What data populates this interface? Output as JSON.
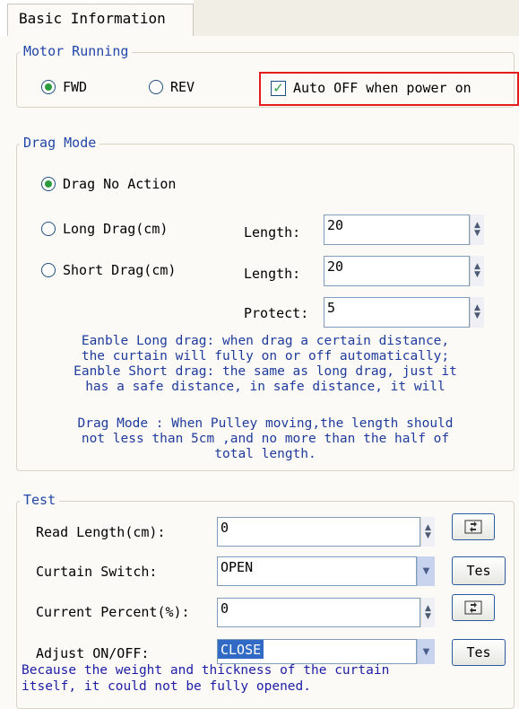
{
  "tab": {
    "label": "Basic Information"
  },
  "motor_running": {
    "legend": "Motor Running",
    "fwd_label": "FWD",
    "rev_label": "REV",
    "selected": "FWD",
    "auto_off_label": "Auto OFF when power on",
    "auto_off_checked": true
  },
  "drag_mode": {
    "legend": "Drag Mode",
    "no_action_label": "Drag No Action",
    "long_drag_label": "Long Drag(cm)",
    "short_drag_label": "Short Drag(cm)",
    "selected": "Drag No Action",
    "long_length_label": "Length:",
    "long_length_value": "20",
    "short_length_label": "Length:",
    "short_length_value": "20",
    "protect_label": "Protect:",
    "protect_value": "5",
    "note1": [
      "Eanble Long drag: when drag a certain distance,",
      "the curtain will fully on or off automatically;",
      "Eanble Short drag: the same as long drag, just it",
      "has a safe distance, in safe distance, it will"
    ],
    "note2": [
      "Drag Mode : When Pulley moving,the length should",
      "not less than  5cm ,and no more than the half of",
      "total length."
    ]
  },
  "test": {
    "legend": "Test",
    "read_length_label": "Read Length(cm):",
    "read_length_value": "0",
    "curtain_switch_label": "Curtain Switch:",
    "curtain_switch_value": "OPEN",
    "curtain_test_button": "Tes",
    "current_percent_label": "Current Percent(%):",
    "current_percent_value": "0",
    "adjust_label": "Adjust ON/OFF:",
    "adjust_value": "CLOSE",
    "adjust_test_button": "Tes"
  },
  "footer_note": [
    "Because the weight and thickness of the curtain",
    "itself, it could not be fully opened."
  ],
  "colors": {
    "legend": "#2146a8",
    "highlight_border": "#e41c1c",
    "check_green": "#2a9c3e",
    "selection": "#316ac5",
    "note_blue": "#1f3b9c"
  }
}
